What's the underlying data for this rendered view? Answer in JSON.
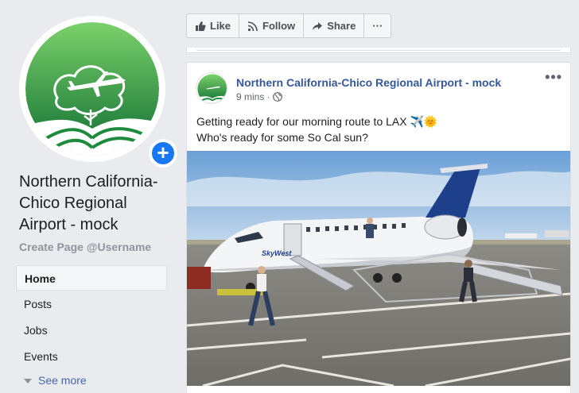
{
  "page": {
    "name": "Northern California-Chico Regional Airport - mock",
    "username_link": "Create Page @Username"
  },
  "nav": {
    "items": [
      {
        "label": "Home",
        "active": true
      },
      {
        "label": "Posts"
      },
      {
        "label": "Jobs"
      },
      {
        "label": "Events"
      }
    ],
    "see_more": "See more"
  },
  "actions": {
    "like": "Like",
    "follow": "Follow",
    "share": "Share",
    "more": "···"
  },
  "post": {
    "author": "Northern California-Chico Regional Airport - mock",
    "time": "9 mins ·",
    "line1": "Getting ready for our morning route to LAX ✈️🌞",
    "line2": "Who's ready for some So Cal sun?",
    "more": "•••",
    "image_tail_text": "SkyWest"
  },
  "colors": {
    "brand_blue": "#1877f2",
    "link_blue": "#365899",
    "logo_green": "#1e8a3c"
  }
}
